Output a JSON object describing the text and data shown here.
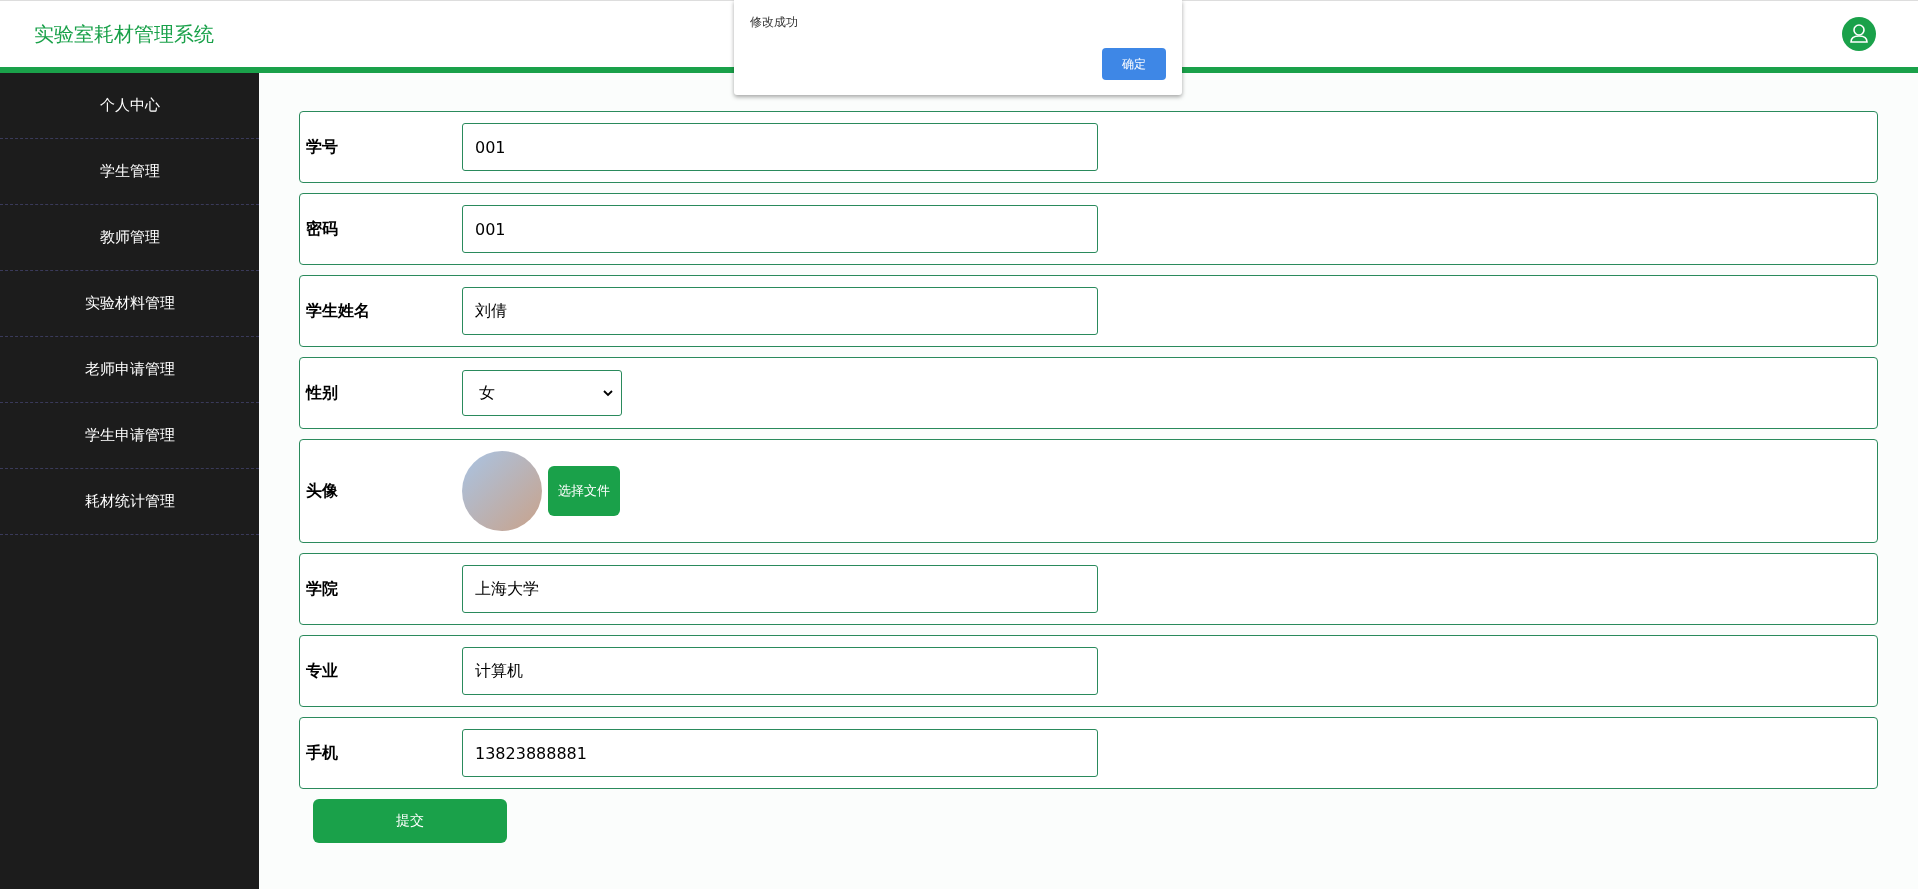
{
  "header": {
    "title": "实验室耗材管理系统"
  },
  "sidebar": {
    "items": [
      {
        "label": "个人中心",
        "selected": false
      },
      {
        "label": "学生管理",
        "selected": false
      },
      {
        "label": "教师管理",
        "selected": false
      },
      {
        "label": "实验材料管理",
        "selected": false
      },
      {
        "label": "老师申请管理",
        "selected": false
      },
      {
        "label": "学生申请管理",
        "selected": false
      },
      {
        "label": "耗材统计管理",
        "selected": false
      }
    ]
  },
  "form": {
    "fields": [
      {
        "kind": "text",
        "label": "学号",
        "value": "001"
      },
      {
        "kind": "text",
        "label": "密码",
        "value": "001"
      },
      {
        "kind": "text",
        "label": "学生姓名",
        "value": "刘倩"
      },
      {
        "kind": "select",
        "label": "性别",
        "value": "女"
      },
      {
        "kind": "avatar",
        "label": "头像",
        "button": "选择文件"
      },
      {
        "kind": "text",
        "label": "学院",
        "value": "上海大学"
      },
      {
        "kind": "text",
        "label": "专业",
        "value": "计算机"
      },
      {
        "kind": "text",
        "label": "手机",
        "value": "13823888881"
      }
    ],
    "submit": "提交"
  },
  "dialog": {
    "message": "修改成功",
    "button": "确定"
  }
}
